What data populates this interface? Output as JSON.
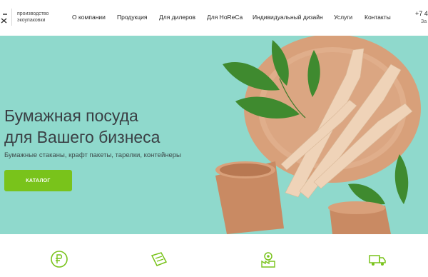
{
  "header": {
    "tagline_line1": "производство",
    "tagline_line2": "экоупаковки",
    "phone": "+7 4",
    "callback": "За"
  },
  "nav": {
    "items": [
      {
        "label": "О компании"
      },
      {
        "label": "Продукция"
      },
      {
        "label": "Для дилеров"
      },
      {
        "label": "Для HoReCa"
      },
      {
        "label": "Индивидуальный дизайн"
      },
      {
        "label": "Услуги"
      },
      {
        "label": "Контакты"
      }
    ]
  },
  "hero": {
    "title_line1": "Бумажная посуда",
    "title_line2": "для Вашего бизнеса",
    "subtitle": "Бумажные стаканы, крафт пакеты, тарелки, контейнеры",
    "button_label": "КАТАЛОГ"
  },
  "features": {
    "items": [
      {
        "icon": "ruble-coin-icon"
      },
      {
        "icon": "wallet-pencil-icon"
      },
      {
        "icon": "factory-gear-icon"
      },
      {
        "icon": "delivery-truck-icon"
      }
    ]
  },
  "colors": {
    "accent_green": "#79c31b",
    "hero_background": "#8fd9cc",
    "kraft": "#d9a27b",
    "leaf": "#3f8a2f"
  }
}
